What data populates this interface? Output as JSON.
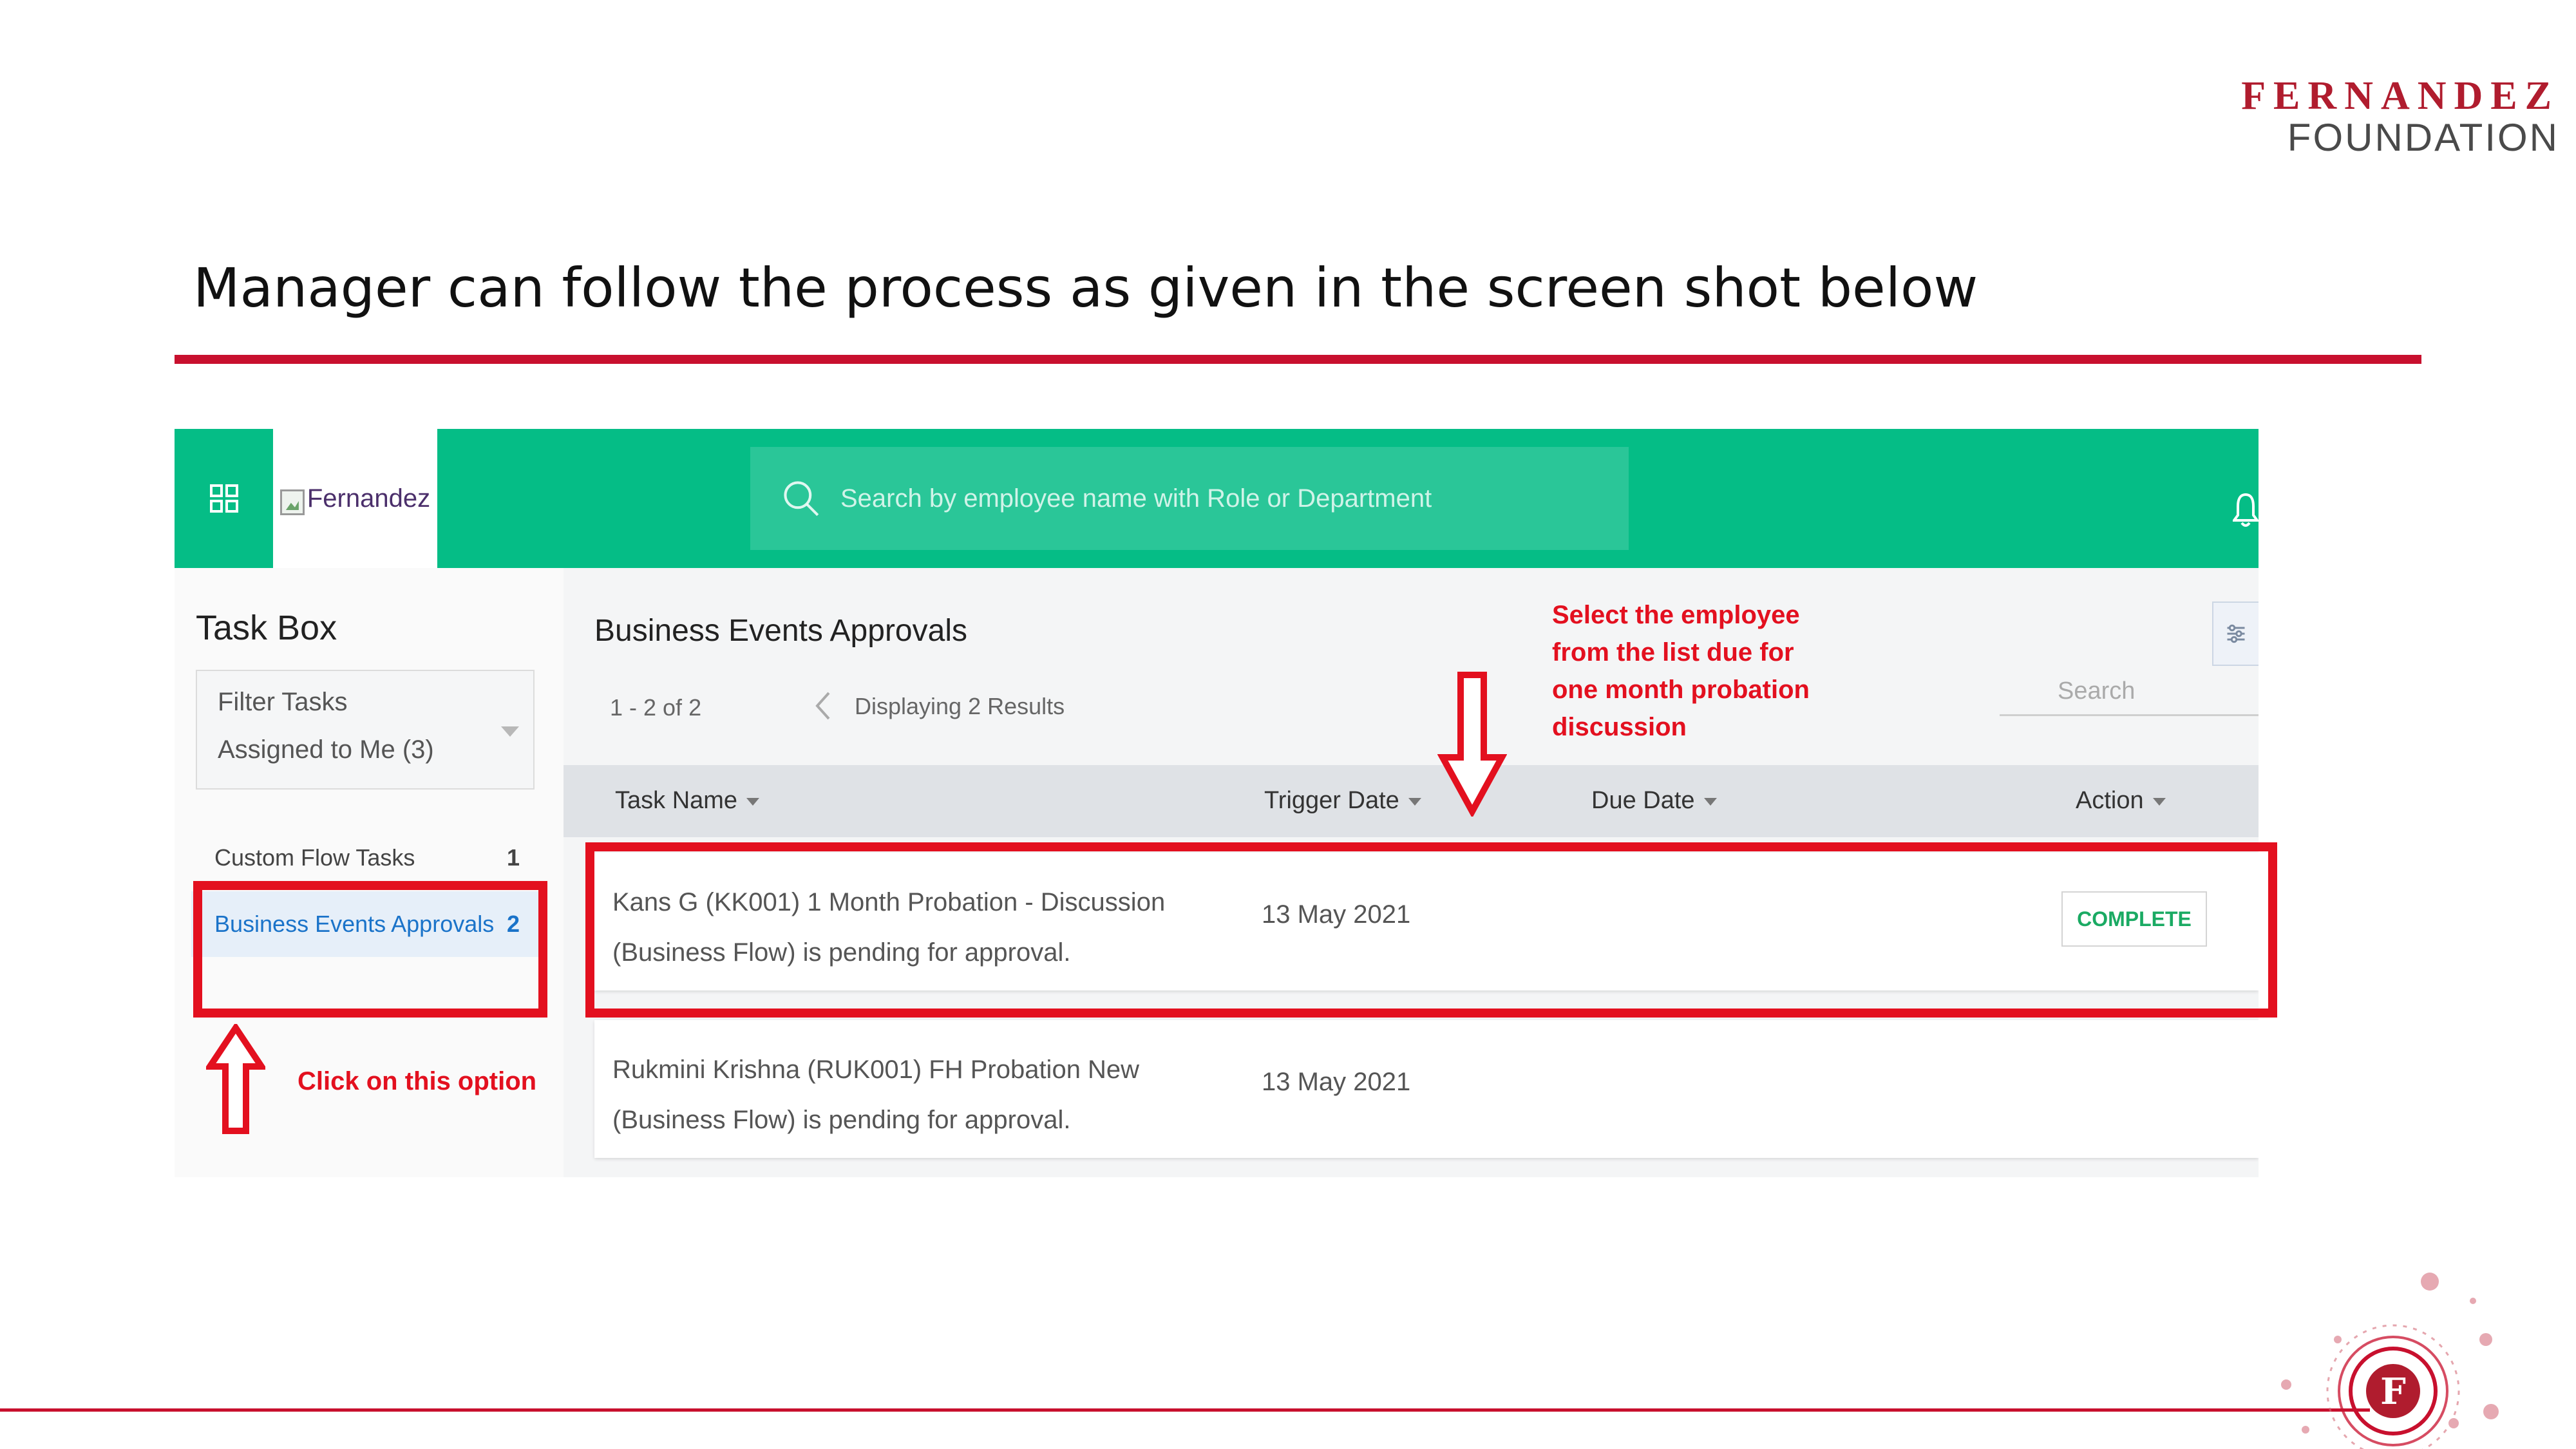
{
  "slide": {
    "logo_line1": "FERNANDEZ",
    "logo_line2": "FOUNDATION",
    "title": "Manager can follow the process as given in the screen shot below",
    "accent_color": "#c8102e"
  },
  "app": {
    "brand_alt": "Fernandez",
    "search_placeholder": "Search by employee name with Role  or Department",
    "header_color": "#05bd86"
  },
  "sidebar": {
    "title": "Task Box",
    "filter_label": "Filter Tasks",
    "filter_value": "Assigned to Me (3)",
    "items": [
      {
        "label": "Custom Flow Tasks",
        "count": "1"
      },
      {
        "label": "Business Events Approvals",
        "count": "2"
      }
    ]
  },
  "main": {
    "title": "Business Events Approvals",
    "pager": "1 - 2 of 2",
    "results": "Displaying 2 Results",
    "search_placeholder": "Search",
    "columns": {
      "task_name": "Task Name",
      "trigger_date": "Trigger Date",
      "due_date": "Due Date",
      "action": "Action"
    },
    "rows": [
      {
        "task": "Kans G (KK001) 1 Month Probation - Discussion (Business Flow) is pending for approval.",
        "trigger_date": "13 May 2021",
        "due_date": "",
        "action": "COMPLETE"
      },
      {
        "task": "Rukmini Krishna (RUK001) FH Probation New (Business Flow) is pending for approval.",
        "trigger_date": "13 May 2021",
        "due_date": "",
        "action": ""
      }
    ]
  },
  "annotations": {
    "click_option": "Click on this option",
    "select_employee": "Select the employee from the list due for one month probation discussion",
    "color": "#e3101f"
  }
}
